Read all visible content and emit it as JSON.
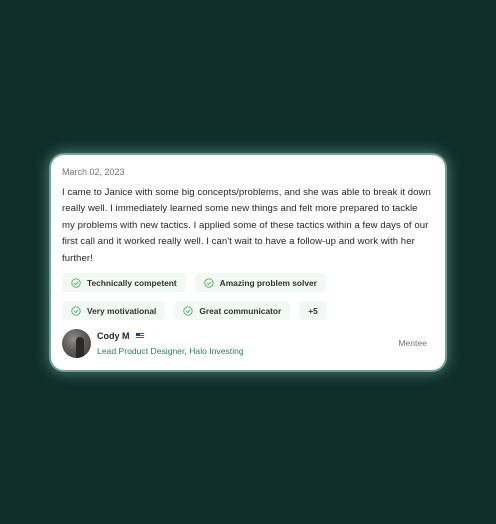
{
  "review": {
    "date": "March 02, 2023",
    "text": "I came to Janice with some big concepts/problems, and she was able to break it down really well. I immediately learned some new things and felt more prepared to tackle my problems with new tactics. I applied some of these tactics within a few days of our first call and it worked really well. I can't wait to have a follow-up and work with her further!",
    "tags_row1": [
      "Technically competent",
      "Amazing problem solver"
    ],
    "tags_row2": [
      "Very motivational",
      "Great communicator"
    ],
    "more_label": "+5",
    "author": {
      "name": "Cody M",
      "flag_icon": "us-flag-icon",
      "title": "Lead Product Designer, Halo Investing"
    },
    "role": "Mentee"
  },
  "colors": {
    "background": "#0f2e2b",
    "chip_bg": "#f2f8f3",
    "chip_icon": "#4caf6a",
    "link": "#2f7a6d"
  }
}
